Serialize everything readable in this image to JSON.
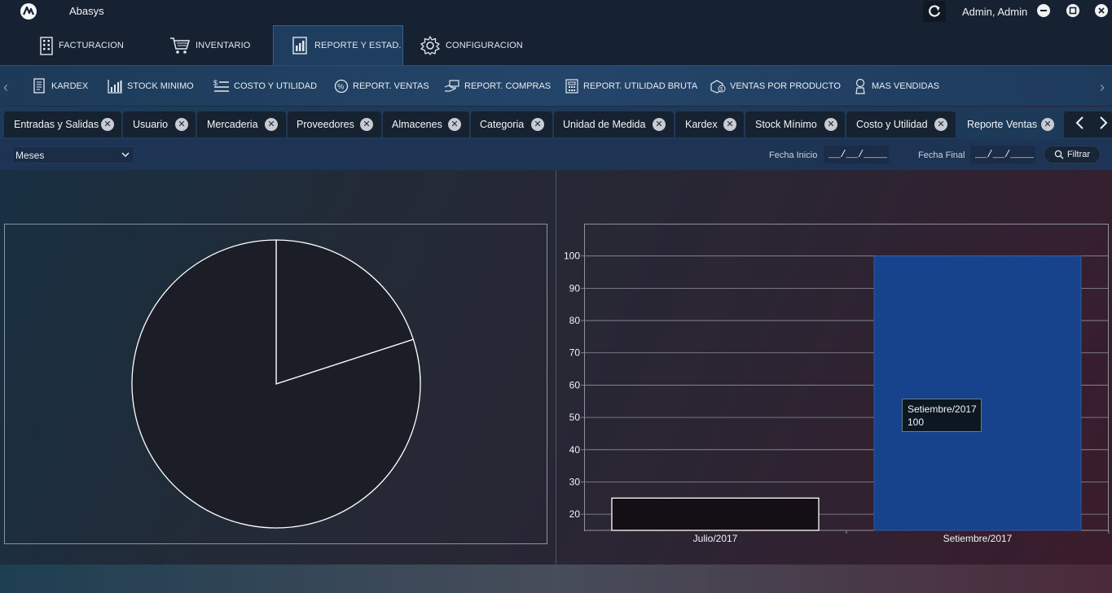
{
  "app": {
    "title": "Abasys",
    "user": "Admin, Admin"
  },
  "main_tabs": [
    {
      "label": "FACTURACION",
      "icon": "building-icon"
    },
    {
      "label": "INVENTARIO",
      "icon": "cart-icon"
    },
    {
      "label": "REPORTE Y ESTAD.",
      "icon": "report-icon",
      "active": true
    },
    {
      "label": "CONFIGURACION",
      "icon": "gear-icon"
    }
  ],
  "ribbon": [
    {
      "label": "KARDEX",
      "icon": "document-list-icon"
    },
    {
      "label": "STOCK MINIMO",
      "icon": "bar-chart-icon"
    },
    {
      "label": "COSTO Y UTILIDAD",
      "icon": "money-list-icon"
    },
    {
      "label": "REPORT. VENTAS",
      "icon": "percent-icon"
    },
    {
      "label": "REPORT. COMPRAS",
      "icon": "hand-cash-icon"
    },
    {
      "label": "REPORT. UTILIDAD BRUTA",
      "icon": "calculator-doc-icon"
    },
    {
      "label": "VENTAS POR PRODUCTO",
      "icon": "box-money-icon"
    },
    {
      "label": "MAS VENDIDAS",
      "icon": "award-icon"
    }
  ],
  "doc_tabs": [
    "Entradas y Salidas",
    "Usuario",
    "Mercaderia",
    "Proveedores",
    "Almacenes",
    "Categoria",
    "Unidad de Medida",
    "Kardex",
    "Stock Mínimo",
    "Costo y Utilidad",
    "Reporte Ventas"
  ],
  "filters": {
    "period": "Meses",
    "start_label": "Fecha Inicio",
    "start_value": "__/__/____",
    "end_label": "Fecha Final",
    "end_value": "__/__/____",
    "button": "Filtrar"
  },
  "tooltip": {
    "category": "Setiembre/2017",
    "value": "100"
  },
  "colors": {
    "bar_active": "#16438b",
    "bar_inactive": "#140f15",
    "pie_fill": "#1b1e26"
  },
  "chart_data": [
    {
      "type": "pie",
      "categories": [
        "Julio/2017",
        "Setiembre/2017"
      ],
      "values": [
        25,
        100
      ]
    },
    {
      "type": "bar",
      "categories": [
        "Julio/2017",
        "Setiembre/2017"
      ],
      "values": [
        25,
        100
      ],
      "ylim": [
        15,
        110
      ],
      "yticks": [
        20,
        30,
        40,
        50,
        60,
        70,
        80,
        90,
        100
      ],
      "grid": true
    }
  ]
}
